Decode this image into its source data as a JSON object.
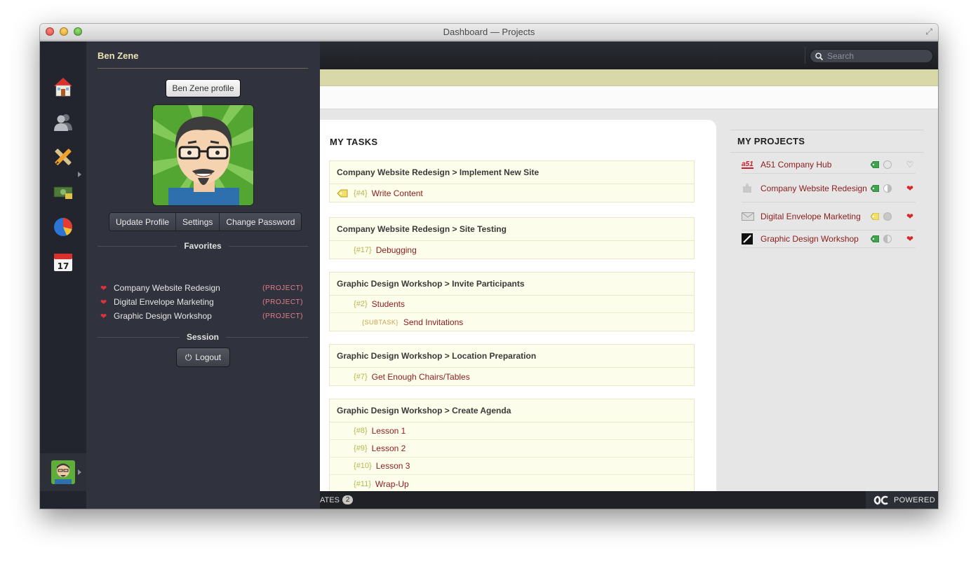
{
  "window": {
    "title": "Dashboard — Projects"
  },
  "user": {
    "name": "Ben Zene",
    "profile_button": "Ben Zene profile",
    "actions": [
      "Update Profile",
      "Settings",
      "Change Password"
    ]
  },
  "favorites": {
    "heading": "Favorites",
    "items": [
      {
        "name": "Company Website Redesign",
        "tag": "PROJECT"
      },
      {
        "name": "Digital Envelope Marketing",
        "tag": "PROJECT"
      },
      {
        "name": "Graphic Design Workshop",
        "tag": "PROJECT"
      }
    ]
  },
  "session": {
    "heading": "Session",
    "logout": "Logout"
  },
  "search": {
    "placeholder": "Search"
  },
  "my_tasks": {
    "title": "MY TASKS",
    "groups": [
      {
        "heading": "Company Website Redesign > Implement New Site",
        "tasks": [
          {
            "id": "#4",
            "name": "Write Content",
            "tagged": true
          }
        ]
      },
      {
        "heading": "Company Website Redesign > Site Testing",
        "tasks": [
          {
            "id": "#17",
            "name": "Debugging"
          }
        ]
      },
      {
        "heading": "Graphic Design Workshop > Invite Participants",
        "tasks": [
          {
            "id": "#2",
            "name": "Students"
          },
          {
            "subtask_label": "SUBTASK",
            "name": "Send Invitations"
          }
        ]
      },
      {
        "heading": "Graphic Design Workshop > Location Preparation",
        "tasks": [
          {
            "id": "#7",
            "name": "Get Enough Chairs/Tables"
          }
        ]
      },
      {
        "heading": "Graphic Design Workshop > Create Agenda",
        "tasks": [
          {
            "id": "#8",
            "name": "Lesson 1"
          },
          {
            "id": "#9",
            "name": "Lesson 2"
          },
          {
            "id": "#10",
            "name": "Lesson 3"
          },
          {
            "id": "#11",
            "name": "Wrap-Up"
          }
        ]
      }
    ]
  },
  "my_projects": {
    "title": "MY PROJECTS",
    "items": [
      {
        "logo_text": "a51",
        "name": "A51 Company Hub",
        "favorite": false
      },
      {
        "name": "Company Website Redesign",
        "favorite": true
      },
      {
        "name": "Digital Envelope Marketing",
        "favorite": true
      },
      {
        "name": "Graphic Design Workshop",
        "favorite": true
      }
    ]
  },
  "footer": {
    "updates_label": "ATES",
    "updates_count": "2",
    "powered_label": "POWERED"
  },
  "calendar_icon": {
    "day": "17"
  },
  "colors": {
    "accent_red": "#8c1c1c",
    "heart": "#e0303a",
    "task_bg": "#fdfdeb",
    "olive_bar": "#d9d8a8"
  }
}
